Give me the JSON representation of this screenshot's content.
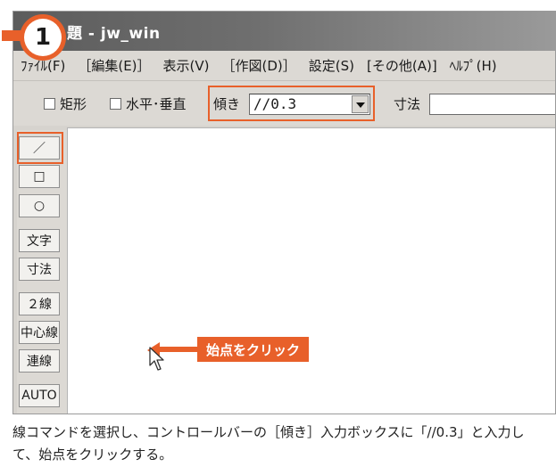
{
  "window": {
    "title": "題 - jw_win"
  },
  "step": {
    "number": "1"
  },
  "menu": {
    "items": [
      "ﾌｧｲﾙ(F)",
      "［編集(E)］",
      "表示(V)",
      "［作図(D)］",
      "設定(S)",
      "[その他(A)]",
      "ﾍﾙﾌﾟ(H)"
    ]
  },
  "controlbar": {
    "rect_label": "矩形",
    "hv_label": "水平･垂直",
    "incline_label": "傾き",
    "incline_value": "//0.3",
    "dimension_label": "寸法",
    "dimension_value": ""
  },
  "toolbar": {
    "line_glyph": "／",
    "rect_glyph": "□",
    "circle_glyph": "○",
    "text_label": "文字",
    "dimension_label": "寸法",
    "double_line_label": "２線",
    "center_line_label": "中心線",
    "continuous_line_label": "連線",
    "auto_label": "AUTO"
  },
  "annotation": {
    "text": "始点をクリック"
  },
  "caption": {
    "text": "線コマンドを選択し、コントロールバーの［傾き］入力ボックスに「//0.3」と入力して、始点をクリックする。"
  },
  "colors": {
    "accent": "#e8602a",
    "titlebar": "#666666",
    "chrome": "#dcd9d4",
    "canvas": "#ffffff"
  }
}
